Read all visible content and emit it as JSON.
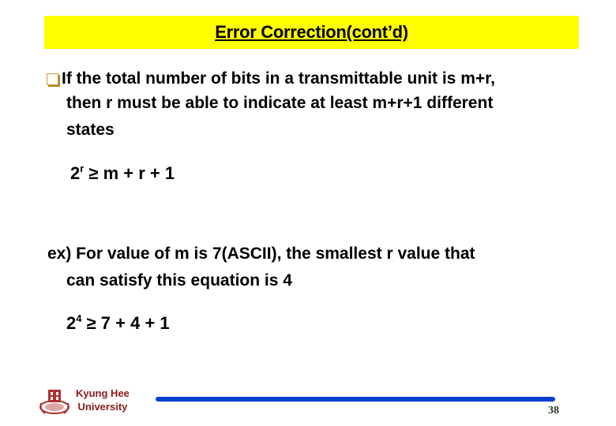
{
  "slide": {
    "title": "Error Correction(cont’d)",
    "bullet": {
      "icon": "hollow-square-bullet",
      "lines": [
        "If the total number of bits in a transmittable unit is m+r,",
        "then r must be able to indicate at least m+r+1 different",
        "states"
      ]
    },
    "formula1": {
      "base": "2",
      "exponent": "r",
      "rest": " ≥ m + r + 1"
    },
    "example": {
      "lines": [
        "ex) For value of  m is 7(ASCII), the smallest r value   that",
        "can satisfy this equation is 4"
      ]
    },
    "formula2": {
      "base": "2",
      "exponent": "4",
      "rest": " ≥ 7 + 4 + 1"
    }
  },
  "footer": {
    "university_line1": "Kyung Hee",
    "university_line2": "University",
    "logo_icon": "university-crest-icon",
    "page_number": "38",
    "accent_color": "#0a3fd6",
    "title_bg_color": "#ffff00"
  }
}
